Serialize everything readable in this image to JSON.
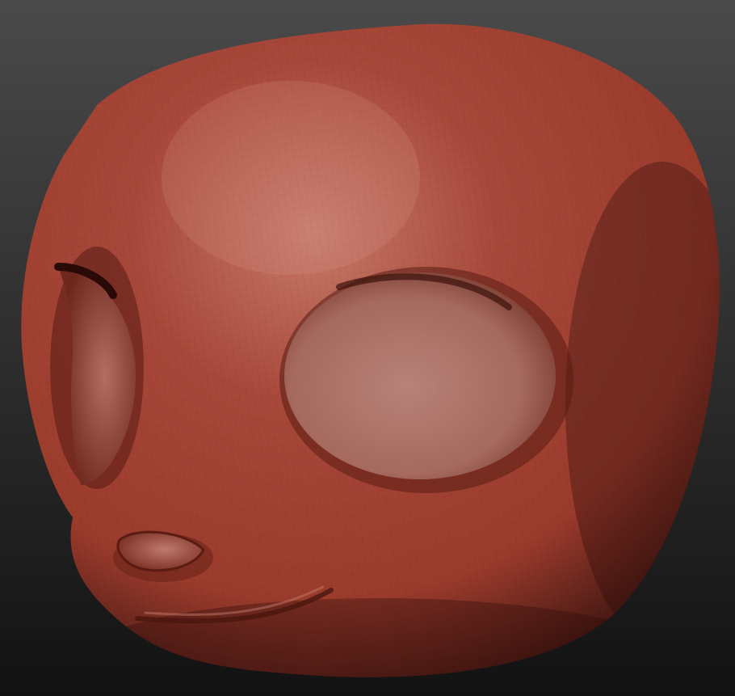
{
  "viewport": {
    "background_top": "#4a4a4a",
    "background_bottom": "#121212"
  },
  "model": {
    "subject": "head-sculpt",
    "material": "red-wax",
    "base_color": "#9b3b2c",
    "highlight_color": "#c77a6a",
    "shadow_color": "#3e1510",
    "wireframe_visible": true
  }
}
